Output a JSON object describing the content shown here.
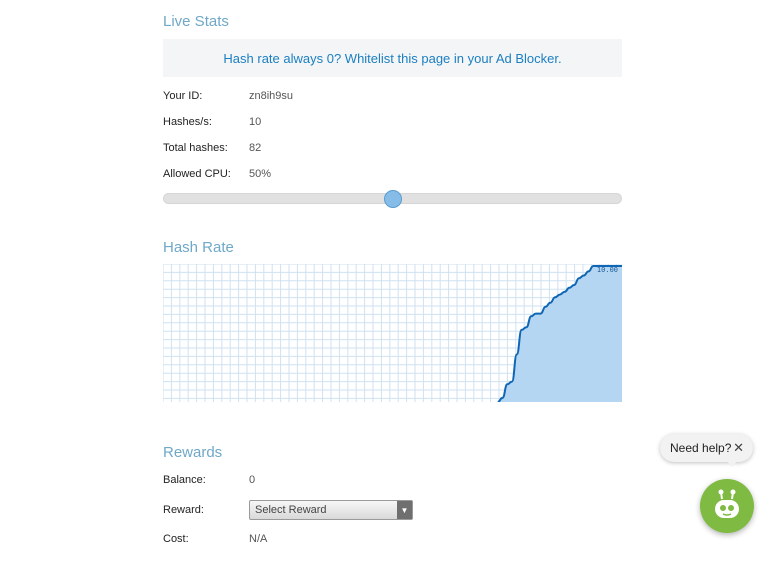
{
  "live_stats": {
    "title": "Live Stats",
    "notice": "Hash rate always 0? Whitelist this page in your Ad Blocker.",
    "rows": [
      {
        "label": "Your ID:",
        "value": "zn8ih9su"
      },
      {
        "label": "Hashes/s:",
        "value": "10"
      },
      {
        "label": "Total hashes:",
        "value": "82"
      },
      {
        "label": "Allowed CPU:",
        "value": "50%"
      }
    ],
    "cpu_slider_fraction": 0.5
  },
  "hash_rate": {
    "title": "Hash Rate",
    "max_label": "10.00"
  },
  "chart_data": {
    "type": "area",
    "title": "Hash Rate",
    "ylim": [
      0,
      10
    ],
    "grid": true,
    "annotation": "10.00",
    "values": [
      0,
      0,
      0,
      0,
      0,
      0,
      0,
      0,
      0,
      0,
      0,
      0,
      0,
      0,
      0,
      0,
      0,
      0,
      0,
      0,
      0,
      0,
      0,
      0,
      0,
      0,
      0,
      0,
      0,
      0,
      0,
      0,
      0,
      0,
      0,
      0,
      0,
      0,
      0,
      0,
      0,
      0,
      0,
      0,
      0,
      0,
      0,
      0,
      0,
      0,
      0,
      0,
      0,
      0,
      0,
      0,
      0,
      0,
      0,
      0,
      0,
      0,
      0,
      0,
      0,
      0,
      0,
      0,
      0,
      0,
      0,
      0.3,
      1.3,
      1.5,
      3.5,
      5.3,
      5.5,
      6.3,
      6.5,
      6.5,
      7.0,
      7.3,
      7.7,
      7.9,
      8.1,
      8.4,
      8.6,
      9.1,
      9.3,
      9.6,
      10,
      10,
      10,
      10,
      10,
      10,
      10
    ]
  },
  "rewards": {
    "title": "Rewards",
    "balance_label": "Balance:",
    "balance_value": "0",
    "reward_label": "Reward:",
    "reward_select": "Select Reward",
    "cost_label": "Cost:",
    "cost_value": "N/A"
  },
  "help_widget": {
    "text": "Need help?",
    "close": "✕"
  },
  "colors": {
    "accent": "#6fa8c8",
    "link": "#1c7fc0",
    "chart_line": "#0f66b4",
    "chart_fill": "#b4d6f2",
    "bot": "#7fba42"
  }
}
